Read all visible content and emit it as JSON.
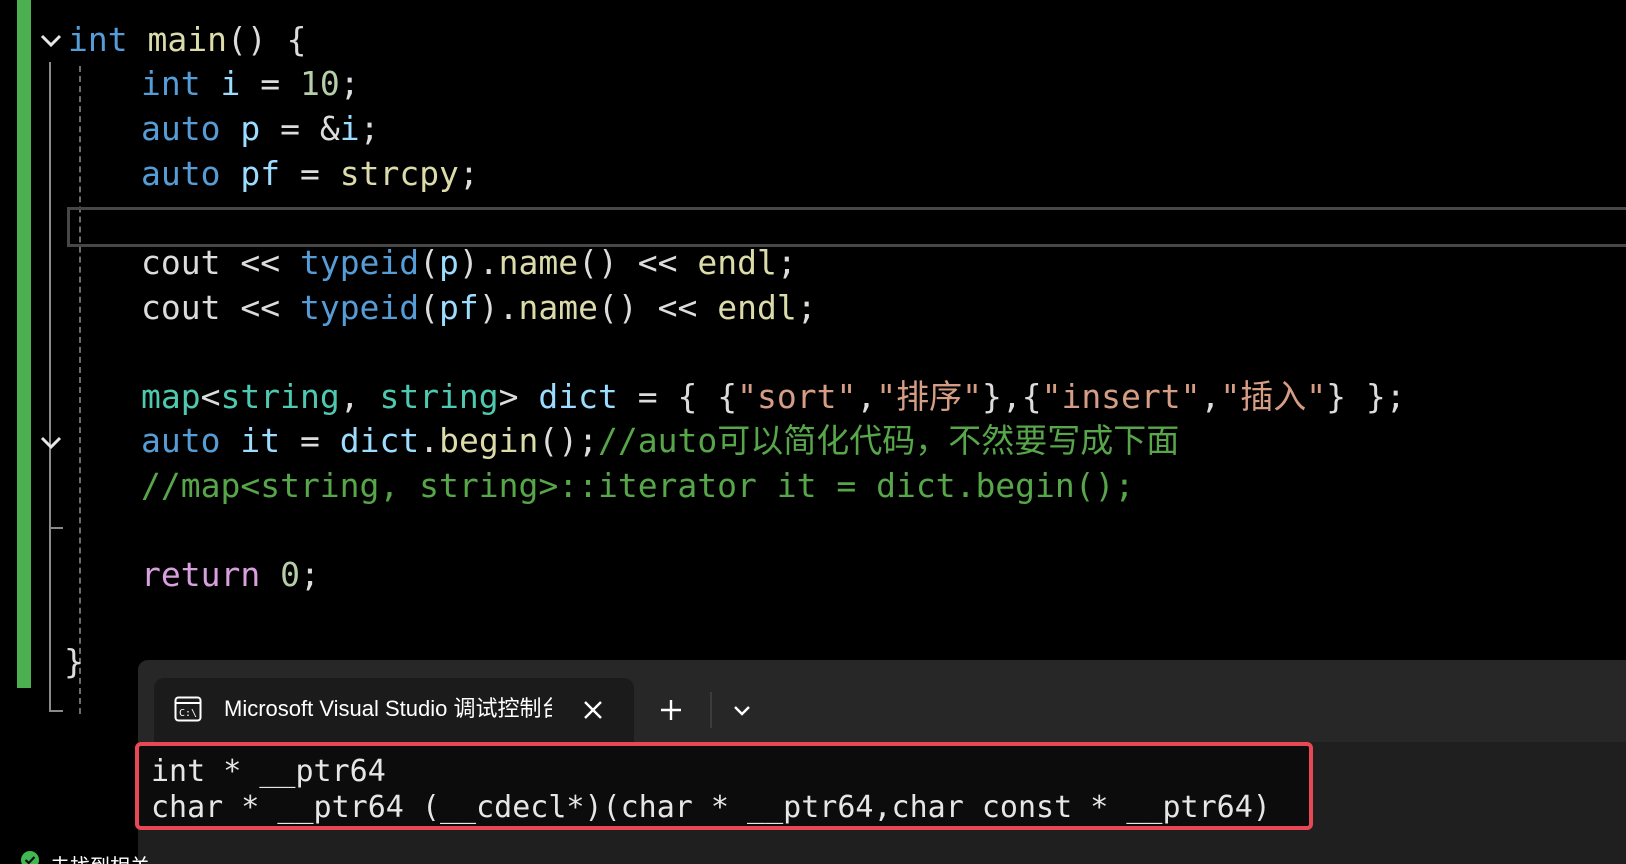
{
  "editor": {
    "lines": [
      {
        "tokens": [
          {
            "c": "kw",
            "t": "int"
          },
          {
            "c": "plain",
            "t": " "
          },
          {
            "c": "fn",
            "t": "main"
          },
          {
            "c": "plain",
            "t": "() {"
          }
        ]
      },
      {
        "tokens": [
          {
            "c": "kw",
            "t": "int"
          },
          {
            "c": "plain",
            "t": " "
          },
          {
            "c": "var",
            "t": "i"
          },
          {
            "c": "plain",
            "t": " = "
          },
          {
            "c": "num",
            "t": "10"
          },
          {
            "c": "plain",
            "t": ";"
          }
        ]
      },
      {
        "tokens": [
          {
            "c": "kw",
            "t": "auto"
          },
          {
            "c": "plain",
            "t": " "
          },
          {
            "c": "var",
            "t": "p"
          },
          {
            "c": "plain",
            "t": " = &"
          },
          {
            "c": "var",
            "t": "i"
          },
          {
            "c": "plain",
            "t": ";"
          }
        ]
      },
      {
        "tokens": [
          {
            "c": "kw",
            "t": "auto"
          },
          {
            "c": "plain",
            "t": " "
          },
          {
            "c": "var",
            "t": "pf"
          },
          {
            "c": "plain",
            "t": " = "
          },
          {
            "c": "fn",
            "t": "strcpy"
          },
          {
            "c": "plain",
            "t": ";"
          }
        ]
      },
      {
        "tokens": []
      },
      {
        "tokens": [
          {
            "c": "plain",
            "t": "cout << "
          },
          {
            "c": "kw",
            "t": "typeid"
          },
          {
            "c": "plain",
            "t": "("
          },
          {
            "c": "var",
            "t": "p"
          },
          {
            "c": "plain",
            "t": ")."
          },
          {
            "c": "fn",
            "t": "name"
          },
          {
            "c": "plain",
            "t": "() << "
          },
          {
            "c": "fn",
            "t": "endl"
          },
          {
            "c": "plain",
            "t": ";"
          }
        ]
      },
      {
        "tokens": [
          {
            "c": "plain",
            "t": "cout << "
          },
          {
            "c": "kw",
            "t": "typeid"
          },
          {
            "c": "plain",
            "t": "("
          },
          {
            "c": "var",
            "t": "pf"
          },
          {
            "c": "plain",
            "t": ")."
          },
          {
            "c": "fn",
            "t": "name"
          },
          {
            "c": "plain",
            "t": "() << "
          },
          {
            "c": "fn",
            "t": "endl"
          },
          {
            "c": "plain",
            "t": ";"
          }
        ]
      },
      {
        "tokens": []
      },
      {
        "tokens": [
          {
            "c": "type",
            "t": "map"
          },
          {
            "c": "plain",
            "t": "<"
          },
          {
            "c": "type",
            "t": "string"
          },
          {
            "c": "plain",
            "t": ", "
          },
          {
            "c": "type",
            "t": "string"
          },
          {
            "c": "plain",
            "t": "> "
          },
          {
            "c": "var",
            "t": "dict"
          },
          {
            "c": "plain",
            "t": " = { {"
          },
          {
            "c": "str",
            "t": "\"sort\""
          },
          {
            "c": "plain",
            "t": ","
          },
          {
            "c": "str",
            "t": "\"排序\""
          },
          {
            "c": "plain",
            "t": "},{"
          },
          {
            "c": "str",
            "t": "\"insert\""
          },
          {
            "c": "plain",
            "t": ","
          },
          {
            "c": "str",
            "t": "\"插入\""
          },
          {
            "c": "plain",
            "t": "} };"
          }
        ]
      },
      {
        "tokens": [
          {
            "c": "kw",
            "t": "auto"
          },
          {
            "c": "plain",
            "t": " "
          },
          {
            "c": "var",
            "t": "it"
          },
          {
            "c": "plain",
            "t": " = "
          },
          {
            "c": "var",
            "t": "dict"
          },
          {
            "c": "plain",
            "t": "."
          },
          {
            "c": "fn",
            "t": "begin"
          },
          {
            "c": "plain",
            "t": "();"
          },
          {
            "c": "cmt",
            "t": "//auto可以简化代码，不然要写成下面"
          }
        ]
      },
      {
        "tokens": [
          {
            "c": "cmt",
            "t": "//map<string, string>::iterator it = dict.begin();"
          }
        ]
      },
      {
        "tokens": []
      },
      {
        "tokens": [
          {
            "c": "ctl",
            "t": "return"
          },
          {
            "c": "plain",
            "t": " "
          },
          {
            "c": "num",
            "t": "0"
          },
          {
            "c": "plain",
            "t": ";"
          }
        ]
      },
      {
        "tokens": []
      },
      {
        "tokens": [
          {
            "c": "plain",
            "t": "}"
          }
        ]
      }
    ]
  },
  "terminal": {
    "tab_title": "Microsoft Visual Studio 调试控制台",
    "output_lines": [
      "int * __ptr64",
      "char * __ptr64 (__cdecl*)(char * __ptr64,char const * __ptr64)"
    ]
  },
  "status": {
    "text": "未找到相关问题"
  },
  "icons": {
    "fold": "chevron-down-icon",
    "terminal": "console-icon",
    "close": "close-icon",
    "new_tab": "plus-icon",
    "dropdown": "chevron-down-icon",
    "status": "check-circle-icon"
  },
  "colors": {
    "gutter_change": "#4caf50",
    "output_highlight": "#e84855"
  }
}
